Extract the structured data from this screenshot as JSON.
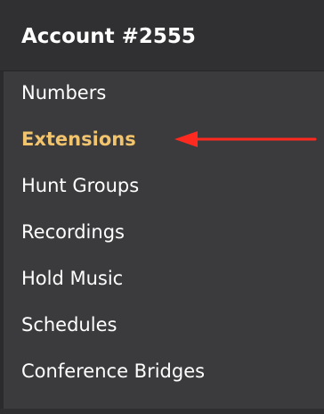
{
  "header": {
    "title": "Account #2555"
  },
  "menu": {
    "items": [
      {
        "label": "Numbers"
      },
      {
        "label": "Extensions",
        "active": true
      },
      {
        "label": "Hunt Groups"
      },
      {
        "label": "Recordings"
      },
      {
        "label": "Hold Music"
      },
      {
        "label": "Schedules"
      },
      {
        "label": "Conference Bridges"
      }
    ]
  },
  "colors": {
    "background": "#3b3b3d",
    "header": "#303033",
    "text": "#ffffff",
    "active": "#f2c46d",
    "arrow": "#ff2a1f"
  },
  "annotation": {
    "icon": "red-arrow-left-icon"
  }
}
